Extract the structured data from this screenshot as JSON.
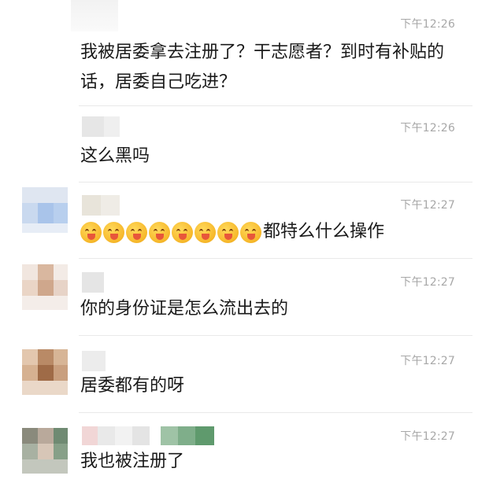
{
  "messages": [
    {
      "time": "下午12:26",
      "text": "我被居委拿去注册了？干志愿者？到时有补贴的话，居委自己吃进？"
    },
    {
      "time": "下午12:26",
      "text": "这么黑吗"
    },
    {
      "time": "下午12:27",
      "emoji_count": 8,
      "emoji_icon": "squinting-face-with-tongue-icon",
      "text": "都特么什么操作"
    },
    {
      "time": "下午12:27",
      "text": "你的身份证是怎么流出去的"
    },
    {
      "time": "下午12:27",
      "text": "居委都有的呀"
    },
    {
      "time": "下午12:27",
      "text": "我也被注册了"
    }
  ],
  "colors": {
    "time": "#a8a8a8",
    "text": "#1a1a1a",
    "separator": "#e9e9e9",
    "background": "#ffffff"
  }
}
